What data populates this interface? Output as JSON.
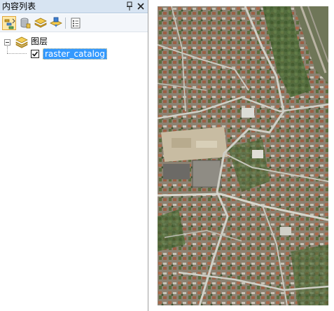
{
  "toc": {
    "title": "内容列表",
    "pin_glyph": "↕",
    "close_glyph": "✕",
    "toolbar": [
      {
        "name": "list-by-drawing-order",
        "icon": "drawing-order-icon",
        "active": true
      },
      {
        "name": "list-by-source",
        "icon": "source-cylinder-icon",
        "active": false
      },
      {
        "name": "list-by-visibility",
        "icon": "visibility-layers-icon",
        "active": false
      },
      {
        "name": "list-by-selection",
        "icon": "selection-icon",
        "active": false
      },
      {
        "name": "options",
        "icon": "options-list-icon",
        "active": false
      }
    ],
    "root": {
      "label": "图层",
      "expanded": true,
      "icon": "layers-stack-icon",
      "children": [
        {
          "label": "raster_catalog",
          "checked": true,
          "selected": true
        }
      ]
    }
  },
  "map": {
    "content": "aerial-imagery-icon",
    "colors": {
      "vegetation": "#4f6b3a",
      "roofs": "#a86a4c",
      "roads": "#cfcfc6",
      "bare": "#c8bca2"
    }
  }
}
